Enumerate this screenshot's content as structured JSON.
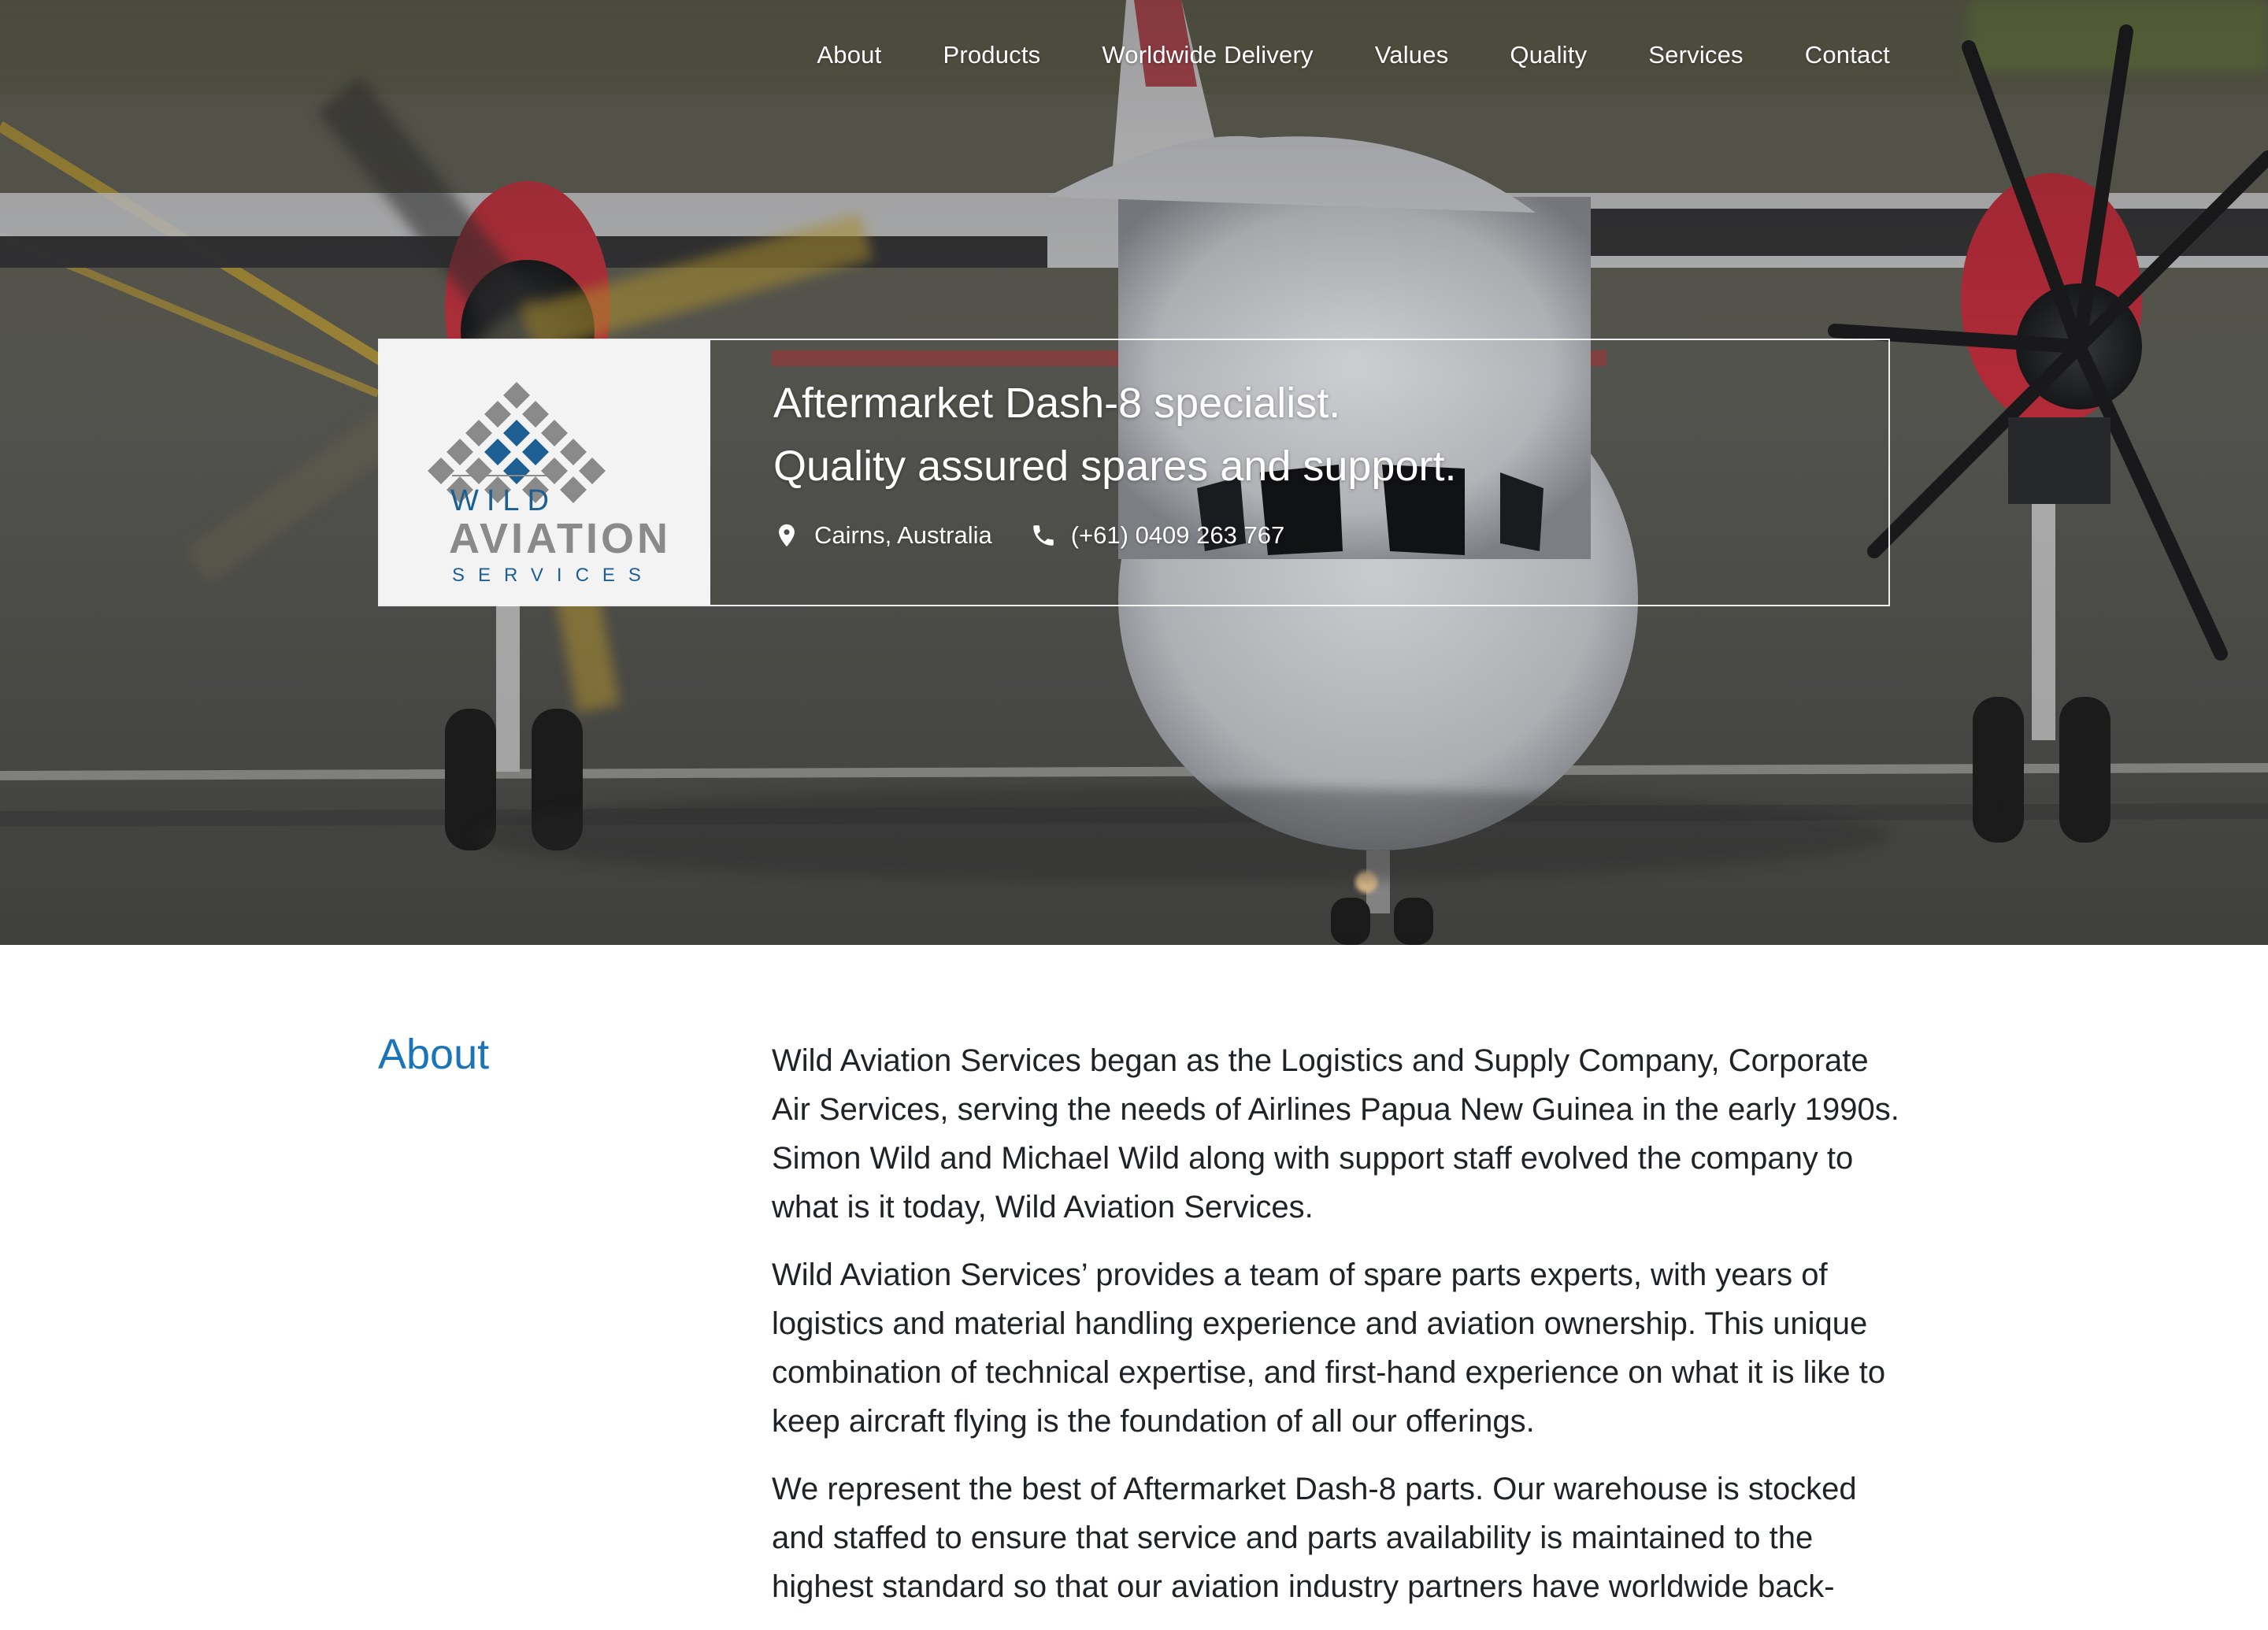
{
  "nav": {
    "items": [
      {
        "label": "About"
      },
      {
        "label": "Products"
      },
      {
        "label": "Worldwide Delivery"
      },
      {
        "label": "Values"
      },
      {
        "label": "Quality"
      },
      {
        "label": "Services"
      },
      {
        "label": "Contact"
      }
    ]
  },
  "logo": {
    "line1": "WILD",
    "line2": "AVIATION",
    "line3": "SERVICES"
  },
  "intro": {
    "tagline_line1": "Aftermarket Dash-8 specialist.",
    "tagline_line2": "Quality assured spares and support.",
    "location": "Cairns, Australia",
    "phone": "(+61) 0409 263 767",
    "location_icon": "map-pin-icon",
    "phone_icon": "phone-icon"
  },
  "about": {
    "heading": "About",
    "paragraphs": [
      "Wild Aviation Services began as the Logistics and Supply Company, Corporate Air Services, serving the needs of Airlines Papua New Guinea in the early 1990s. Simon Wild and Michael Wild along with support staff evolved the company to what is it today, Wild Aviation Services.",
      "Wild Aviation Services’ provides a team of spare parts experts, with years of logistics and material handling experience and aviation ownership. This unique combination of technical expertise, and first-hand experience on what it is like to keep aircraft flying is the foundation of all our offerings.",
      "We represent the best of Aftermarket Dash-8 parts. Our warehouse is stocked and staffed to ensure that service and parts availability is maintained to the highest standard so that our aviation industry partners have worldwide back-"
    ]
  },
  "colors": {
    "accent": "#1a74b8",
    "logo_blue": "#1d5f93",
    "logo_grey": "#8a8a8a",
    "text": "#1f2226"
  }
}
